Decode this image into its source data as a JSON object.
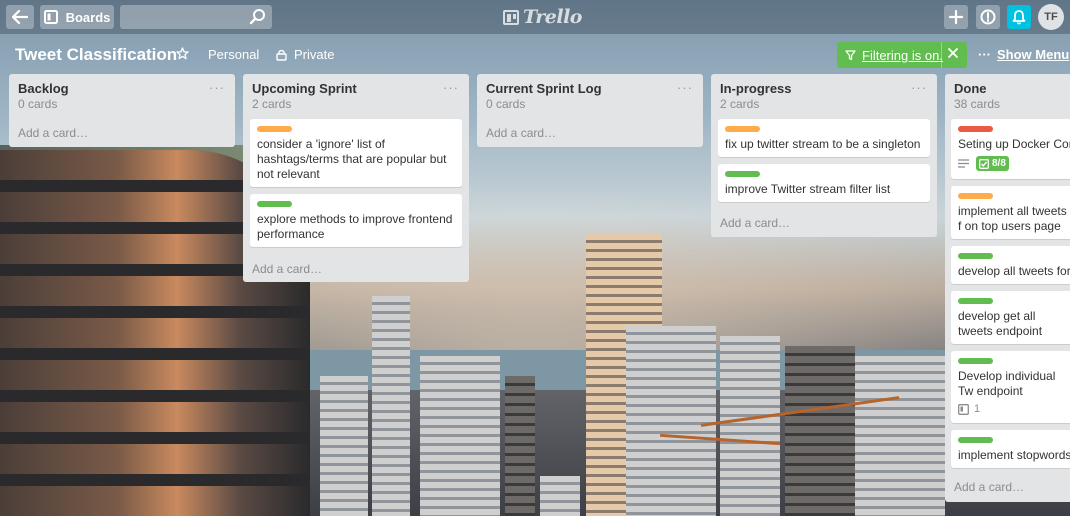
{
  "header": {
    "back_icon": "back-arrow-icon",
    "boards_label": "Boards",
    "search_value": "",
    "logo_text": "Trello",
    "avatar_initials": "TF"
  },
  "board": {
    "title": "Tweet Classification",
    "team": "Personal",
    "visibility": "Private",
    "filter_label": "Filtering is on.",
    "show_menu_label": "Show Menu",
    "menu_dots": "···"
  },
  "colors": {
    "orange": "#ffab4a",
    "green": "#61bd4f",
    "red": "#eb5a46",
    "notification": "#00c2e0"
  },
  "lists": [
    {
      "title": "Backlog",
      "count": "0 cards",
      "menu": "···",
      "add_card": "Add a card…",
      "cards": []
    },
    {
      "title": "Upcoming Sprint",
      "count": "2 cards",
      "menu": "···",
      "add_card": "Add a card…",
      "cards": [
        {
          "label_color": "orange",
          "text": "consider a 'ignore' list of hashtags/terms that are popular but not relevant"
        },
        {
          "label_color": "green",
          "text": "explore methods to improve frontend performance"
        }
      ]
    },
    {
      "title": "Current Sprint Log",
      "count": "0 cards",
      "menu": "···",
      "add_card": "Add a card…",
      "cards": []
    },
    {
      "title": "In-progress",
      "count": "2 cards",
      "menu": "···",
      "add_card": "Add a card…",
      "cards": [
        {
          "label_color": "orange",
          "text": "fix up twitter stream to be a singleton"
        },
        {
          "label_color": "green",
          "text": "improve Twitter stream filter list"
        }
      ]
    },
    {
      "title": "Done",
      "count": "38 cards",
      "menu": "···",
      "add_card": "Add a card…",
      "cards": [
        {
          "label_color": "red",
          "text": "Seting up Docker Cor",
          "checklist": "8/8"
        },
        {
          "label_color": "orange",
          "text": "implement all tweets f on top users page"
        },
        {
          "label_color": "green",
          "text": "develop all tweets for"
        },
        {
          "label_color": "green",
          "text": "develop get all tweets endpoint"
        },
        {
          "label_color": "green",
          "text": "Develop individual Tw endpoint",
          "attachments": "1"
        },
        {
          "label_color": "green",
          "text": "implement stopwords"
        }
      ]
    }
  ]
}
